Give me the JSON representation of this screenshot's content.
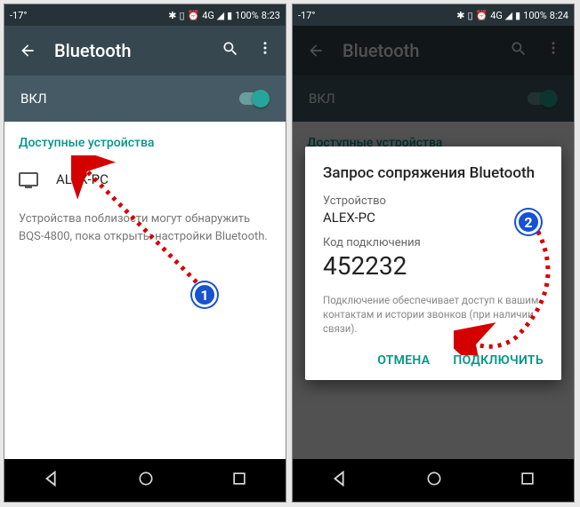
{
  "screen1": {
    "status": {
      "temp": "-17°",
      "battery": "100%",
      "time": "8:23"
    },
    "title": "Bluetooth",
    "toggle_label": "ВКЛ",
    "section_header": "Доступные устройства",
    "device_name": "ALEX-PC",
    "hint": "Устройства поблизости могут обнаружить BQS-4800, пока открыты настройки Bluetooth."
  },
  "screen2": {
    "status": {
      "temp": "-17°",
      "battery": "100%",
      "time": "8:24"
    },
    "title": "Bluetooth",
    "toggle_label": "ВКЛ",
    "section_header": "Доступные устройства",
    "dialog": {
      "title": "Запрос сопряжения Bluetooth",
      "device_label": "Устройство",
      "device_name": "ALEX-PC",
      "code_label": "Код подключения",
      "code": "452232",
      "note": "Подключение обеспечивает доступ к вашим контактам и истории звонков (при наличии связи).",
      "cancel": "ОТМЕНА",
      "confirm": "ПОДКЛЮЧИТЬ"
    }
  },
  "annotations": {
    "badge1": "1",
    "badge2": "2"
  }
}
